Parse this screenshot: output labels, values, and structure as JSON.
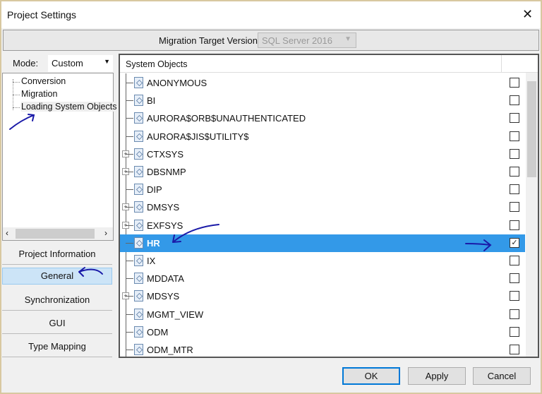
{
  "window": {
    "title": "Project Settings",
    "close": "✕"
  },
  "topbar": {
    "label": "Migration Target Version :",
    "value": "SQL Server 2016"
  },
  "mode": {
    "label": "Mode:",
    "value": "Custom"
  },
  "tree": [
    "Conversion",
    "Migration",
    "Loading System Objects"
  ],
  "nav": [
    {
      "label": "Project Information",
      "selected": false
    },
    {
      "label": "General",
      "selected": true
    },
    {
      "label": "Synchronization",
      "selected": false
    },
    {
      "label": "GUI",
      "selected": false
    },
    {
      "label": "Type Mapping",
      "selected": false
    }
  ],
  "list": {
    "header": "System Objects",
    "rows": [
      {
        "name": "ANONYMOUS",
        "expandable": false,
        "checked": false
      },
      {
        "name": "BI",
        "expandable": false,
        "checked": false
      },
      {
        "name": "AURORA$ORB$UNAUTHENTICATED",
        "expandable": false,
        "checked": false
      },
      {
        "name": "AURORA$JIS$UTILITY$",
        "expandable": false,
        "checked": false
      },
      {
        "name": "CTXSYS",
        "expandable": true,
        "checked": false
      },
      {
        "name": "DBSNMP",
        "expandable": true,
        "checked": false
      },
      {
        "name": "DIP",
        "expandable": false,
        "checked": false
      },
      {
        "name": "DMSYS",
        "expandable": true,
        "checked": false
      },
      {
        "name": "EXFSYS",
        "expandable": true,
        "checked": false
      },
      {
        "name": "HR",
        "expandable": false,
        "checked": true,
        "selected": true
      },
      {
        "name": "IX",
        "expandable": false,
        "checked": false
      },
      {
        "name": "MDDATA",
        "expandable": false,
        "checked": false
      },
      {
        "name": "MDSYS",
        "expandable": true,
        "checked": false
      },
      {
        "name": "MGMT_VIEW",
        "expandable": false,
        "checked": false
      },
      {
        "name": "ODM",
        "expandable": false,
        "checked": false
      },
      {
        "name": "ODM_MTR",
        "expandable": false,
        "checked": false
      }
    ]
  },
  "buttons": {
    "ok": "OK",
    "apply": "Apply",
    "cancel": "Cancel"
  },
  "colors": {
    "selection": "#3399e8",
    "annotation": "#1a1aa8",
    "default_button_border": "#0078d7"
  }
}
